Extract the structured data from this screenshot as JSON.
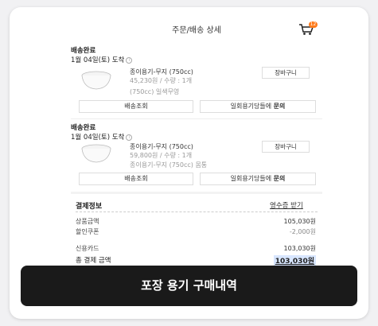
{
  "header": {
    "title": "주문/배송 상세",
    "cart_badge": "12"
  },
  "orders": [
    {
      "status": "배송완료",
      "date": "1월 04일(토) 도착",
      "product_name": "종이용기-무지 (750cc)",
      "product_meta": "45,230원 / 수량 : 1개",
      "product_option": "(750cc) 일색무영",
      "cart_button": "장바구니",
      "track_button": "배송조회",
      "inquiry_button_prefix": "일회용기당들에 ",
      "inquiry_button_bold": "문의"
    },
    {
      "status": "배송완료",
      "date": "1월 04일(토) 도착",
      "product_name": "종이용기-무지 (750cc)",
      "product_meta": "59,800원 / 수량 : 1개",
      "product_option": "종이용기-무지 (750cc) 몸통",
      "cart_button": "장바구니",
      "track_button": "배송조회",
      "inquiry_button_prefix": "일회용기당들에 ",
      "inquiry_button_bold": "문의"
    }
  ],
  "payment": {
    "title": "결제정보",
    "receipt_link": "영수증 받기",
    "product_amount_label": "상품금액",
    "product_amount": "105,030원",
    "discount_label": "할인쿠폰",
    "discount_amount": "-2,000원",
    "card_label": "신용카드",
    "card_amount": "103,030원",
    "total_label": "총 결제 금액",
    "total_amount": "103,030원"
  },
  "banner": {
    "text": "포장 용기 구매내역"
  }
}
